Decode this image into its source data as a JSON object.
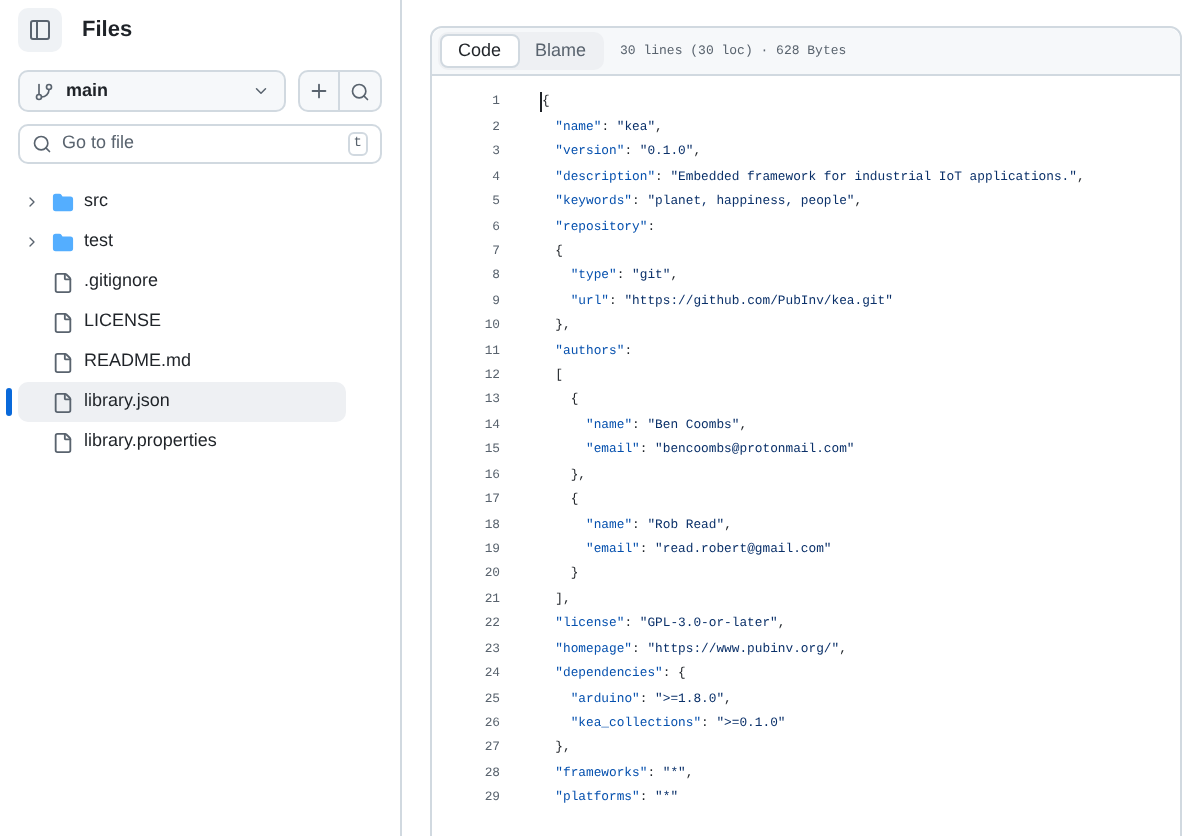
{
  "sidebar": {
    "title": "Files",
    "branch": "main",
    "search": {
      "placeholder": "Go to file",
      "shortcut": "t"
    },
    "tree": [
      {
        "name": "src",
        "kind": "folder",
        "expanded": false,
        "selected": false
      },
      {
        "name": "test",
        "kind": "folder",
        "expanded": false,
        "selected": false
      },
      {
        "name": ".gitignore",
        "kind": "file",
        "selected": false
      },
      {
        "name": "LICENSE",
        "kind": "file",
        "selected": false
      },
      {
        "name": "README.md",
        "kind": "file",
        "selected": false
      },
      {
        "name": "library.json",
        "kind": "file",
        "selected": true
      },
      {
        "name": "library.properties",
        "kind": "file",
        "selected": false
      }
    ]
  },
  "viewer": {
    "tabs": [
      {
        "label": "Code",
        "selected": true
      },
      {
        "label": "Blame",
        "selected": false
      }
    ],
    "info": "30 lines (30 loc) · 628 Bytes",
    "lines": [
      {
        "number": "1",
        "text": "{"
      },
      {
        "number": "2",
        "text": "  \"name\": \"kea\","
      },
      {
        "number": "3",
        "text": "  \"version\": \"0.1.0\","
      },
      {
        "number": "4",
        "text": "  \"description\": \"Embedded framework for industrial IoT applications.\","
      },
      {
        "number": "5",
        "text": "  \"keywords\": \"planet, happiness, people\","
      },
      {
        "number": "6",
        "text": "  \"repository\":"
      },
      {
        "number": "7",
        "text": "  {"
      },
      {
        "number": "8",
        "text": "    \"type\": \"git\","
      },
      {
        "number": "9",
        "text": "    \"url\": \"https://github.com/PubInv/kea.git\""
      },
      {
        "number": "10",
        "text": "  },"
      },
      {
        "number": "11",
        "text": "  \"authors\":"
      },
      {
        "number": "12",
        "text": "  ["
      },
      {
        "number": "13",
        "text": "    {"
      },
      {
        "number": "14",
        "text": "      \"name\": \"Ben Coombs\","
      },
      {
        "number": "15",
        "text": "      \"email\": \"bencoombs@protonmail.com\""
      },
      {
        "number": "16",
        "text": "    },"
      },
      {
        "number": "17",
        "text": "    {"
      },
      {
        "number": "18",
        "text": "      \"name\": \"Rob Read\","
      },
      {
        "number": "19",
        "text": "      \"email\": \"read.robert@gmail.com\""
      },
      {
        "number": "20",
        "text": "    }"
      },
      {
        "number": "21",
        "text": "  ],"
      },
      {
        "number": "22",
        "text": "  \"license\": \"GPL-3.0-or-later\","
      },
      {
        "number": "23",
        "text": "  \"homepage\": \"https://www.pubinv.org/\","
      },
      {
        "number": "24",
        "text": "  \"dependencies\": {"
      },
      {
        "number": "25",
        "text": "    \"arduino\": \">=1.8.0\","
      },
      {
        "number": "26",
        "text": "    \"kea_collections\": \">=0.1.0\""
      },
      {
        "number": "27",
        "text": "  },"
      },
      {
        "number": "28",
        "text": "  \"frameworks\": \"*\","
      },
      {
        "number": "29",
        "text": "  \"platforms\": \"*\""
      }
    ]
  }
}
